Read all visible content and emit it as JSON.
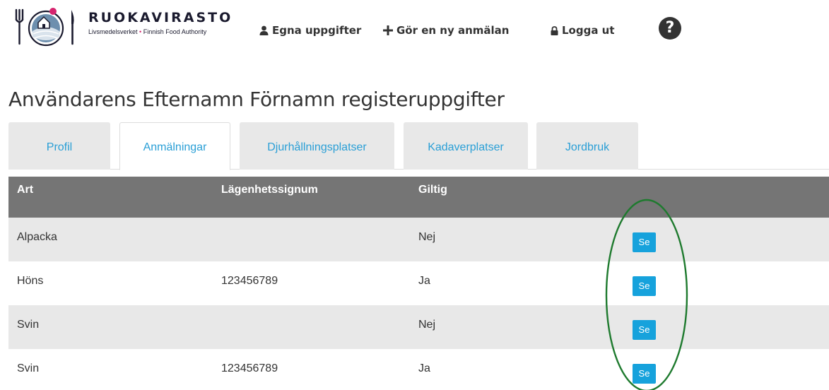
{
  "header": {
    "brand_name": "RUOKAVIRASTO",
    "brand_sub_left": "Livsmedelsverket",
    "brand_sub_sep": "•",
    "brand_sub_right": "Finnish Food Authority",
    "nav": {
      "own_info": "Egna uppgifter",
      "new_report": "Gör en ny anmälan",
      "logout": "Logga ut"
    },
    "help_glyph": "?"
  },
  "page": {
    "title": "Användarens Efternamn Förnamn registeruppgifter"
  },
  "tabs": [
    {
      "label": "Profil",
      "active": false
    },
    {
      "label": "Anmälningar",
      "active": true
    },
    {
      "label": "Djurhållningsplatser",
      "active": false
    },
    {
      "label": "Kadaverplatser",
      "active": false
    },
    {
      "label": "Jordbruk",
      "active": false
    }
  ],
  "table": {
    "columns": {
      "art": "Art",
      "signum": "Lägenhetssignum",
      "giltig": "Giltig"
    },
    "rows": [
      {
        "art": "Alpacka",
        "signum": "",
        "giltig": "Nej",
        "action": "Se"
      },
      {
        "art": "Höns",
        "signum": "123456789",
        "giltig": "Ja",
        "action": "Se"
      },
      {
        "art": "Svin",
        "signum": "",
        "giltig": "Nej",
        "action": "Se"
      },
      {
        "art": "Svin",
        "signum": "123456789",
        "giltig": "Ja",
        "action": "Se"
      }
    ]
  },
  "icons": {
    "logo": "ruokavirasto-logo-icon",
    "own_info": "user-icon",
    "new_report": "plus-icon",
    "logout": "lock-icon",
    "help": "question-circle-icon"
  },
  "colors": {
    "link": "#2a9fd6",
    "header_row": "#757575",
    "row_shade": "#e8e8e8",
    "button": "#16a2dc",
    "annotation": "#1e7a2e",
    "brand_dot": "#d6246e"
  }
}
